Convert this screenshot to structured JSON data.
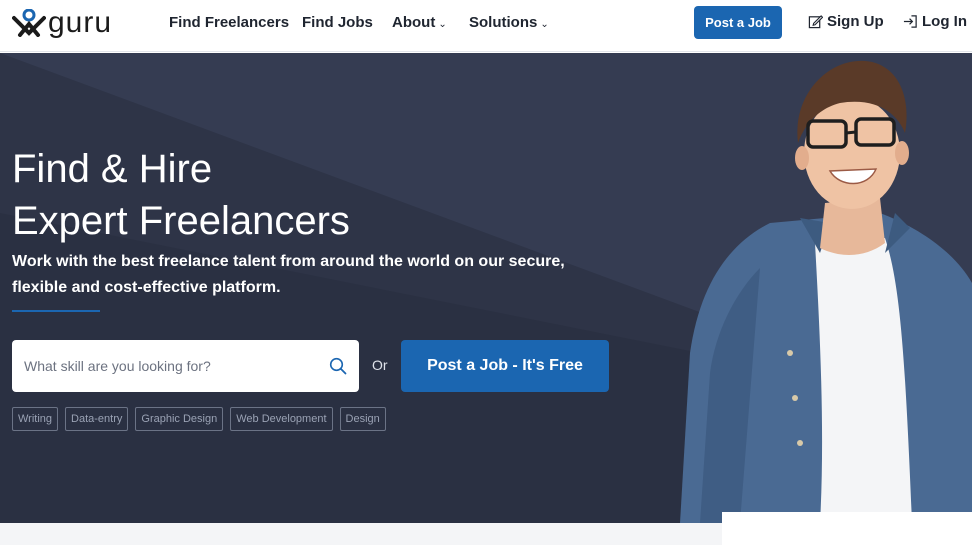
{
  "nav": {
    "logo": "guru",
    "links": [
      {
        "label": "Find Freelancers",
        "dropdown": false
      },
      {
        "label": "Find Jobs",
        "dropdown": false
      },
      {
        "label": "About",
        "dropdown": true
      },
      {
        "label": "Solutions",
        "dropdown": true
      }
    ],
    "post_job": "Post a Job",
    "sign_up": "Sign Up",
    "log_in": "Log In"
  },
  "hero": {
    "title_line1": "Find & Hire",
    "title_line2": "Expert Freelancers",
    "subtitle": "Work with the best freelance talent from around the world on our secure, flexible and cost-effective platform.",
    "search_placeholder": "What skill are you looking for?",
    "or_label": "Or",
    "post_job_button": "Post a Job - It's Free",
    "tags": [
      "Writing",
      "Data-entry",
      "Graphic Design",
      "Web Development",
      "Design"
    ]
  },
  "colors": {
    "brand_blue": "#1b66b1",
    "hero_bg": "#2e3447"
  }
}
